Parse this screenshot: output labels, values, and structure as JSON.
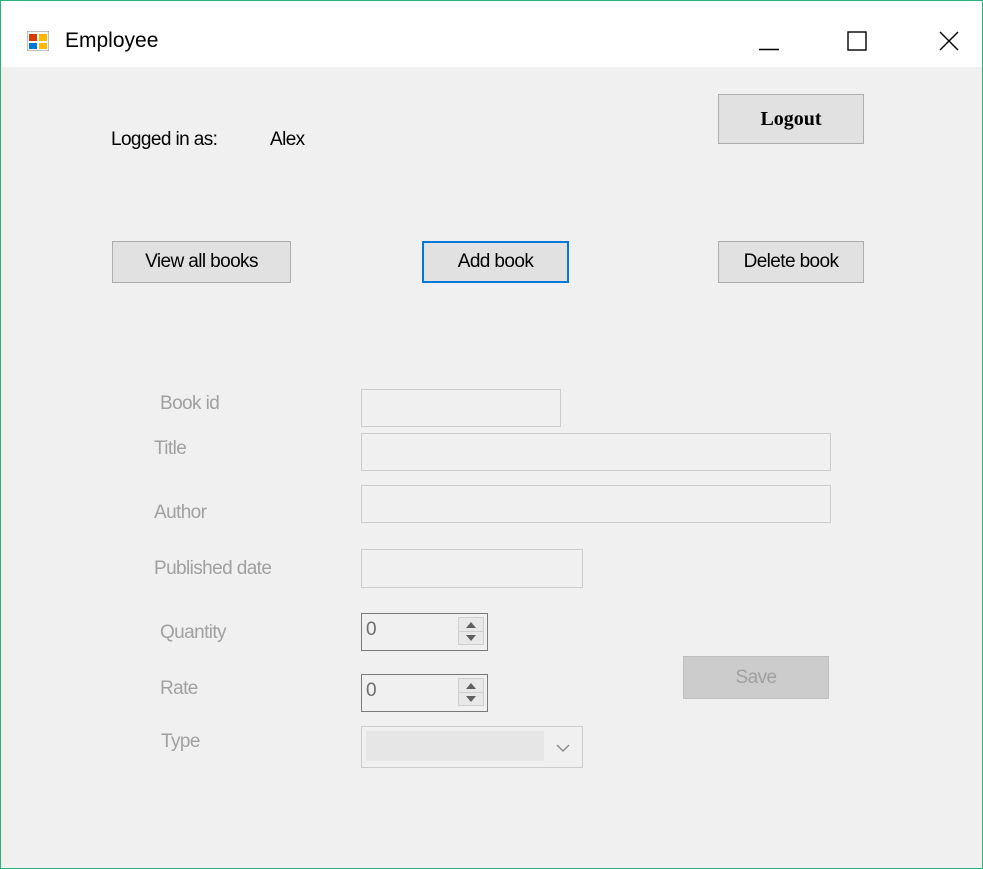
{
  "window": {
    "title": "Employee"
  },
  "header": {
    "logged_in_label": "Logged in as:",
    "username": "Alex",
    "logout_label": "Logout"
  },
  "actions": {
    "view_all_label": "View all books",
    "add_label": "Add book",
    "delete_label": "Delete book"
  },
  "form": {
    "book_id_label": "Book id",
    "book_id_value": "",
    "title_label": "Title",
    "title_value": "",
    "author_label": "Author",
    "author_value": "",
    "published_label": "Published date",
    "published_value": "",
    "quantity_label": "Quantity",
    "quantity_value": "0",
    "rate_label": "Rate",
    "rate_value": "0",
    "type_label": "Type",
    "type_value": "",
    "save_label": "Save"
  },
  "colors": {
    "focus_border": "#0078d7",
    "window_border": "#2ab27b",
    "disabled_text": "#a0a0a0"
  },
  "icons": {
    "app": "app-window-icon",
    "minimize": "minimize-icon",
    "maximize": "maximize-icon",
    "close": "close-icon",
    "dropdown": "chevron-down-icon"
  }
}
